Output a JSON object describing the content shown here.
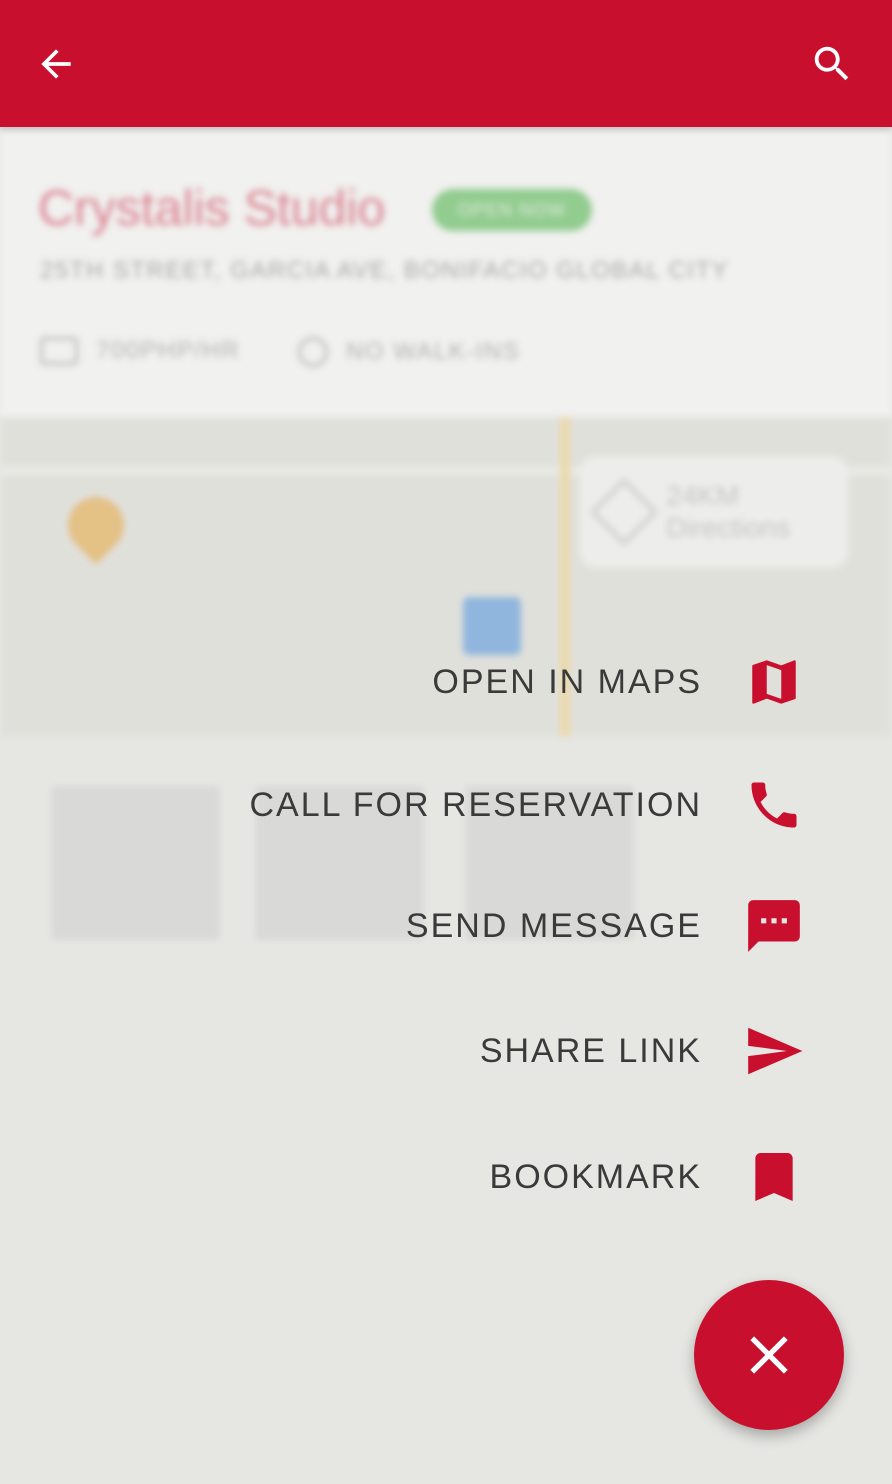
{
  "colors": {
    "primary": "#c8102e",
    "overlay": "#e6e6e3",
    "text": "#3a3a3a",
    "open_badge": "#4fb84c"
  },
  "appbar": {
    "back_icon": "arrow-back-icon",
    "search_icon": "search-icon"
  },
  "background": {
    "studio_name": "Crystalis Studio",
    "status_badge": "OPEN NOW",
    "address": "25TH STREET, GARCIA AVE, BONIFACIO GLOBAL CITY",
    "price": "700PHP/HR",
    "walk_in": "NO WALK-INS",
    "map": {
      "distance": "24KM",
      "directions_label": "Directions"
    }
  },
  "speed_dial": {
    "items": [
      {
        "label": "OPEN IN MAPS",
        "icon": "map-icon"
      },
      {
        "label": "CALL FOR RESERVATION",
        "icon": "phone-icon"
      },
      {
        "label": "SEND MESSAGE",
        "icon": "message-icon"
      },
      {
        "label": "SHARE LINK",
        "icon": "send-icon"
      },
      {
        "label": "BOOKMARK",
        "icon": "bookmark-icon"
      }
    ],
    "close_icon": "close-icon"
  }
}
